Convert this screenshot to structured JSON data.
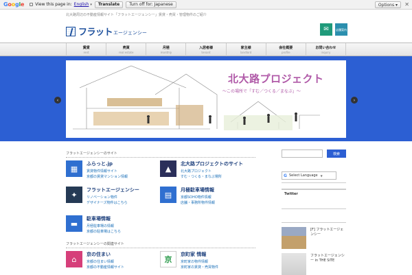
{
  "translate_bar": {
    "logo_letters": [
      "G",
      "o",
      "o",
      "g",
      "l",
      "e"
    ],
    "view_label": "View this page in:",
    "language": "English",
    "translate_label": "Translate",
    "turn_off_label": "Turn off for: Japanese",
    "options_label": "Options ▾",
    "close_label": "✕"
  },
  "header": {
    "tagline": "北大路周辺の不動産情報サイト「フラットエージェンシー」賃貸・売買・管理物件のご紹介",
    "logo_main": "フラット",
    "logo_sub": "エージェンシー",
    "mail_icon": "✉",
    "contact_label": "店舗案内"
  },
  "nav": [
    {
      "jp": "賃貸",
      "en": "rent"
    },
    {
      "jp": "売買",
      "en": "real estate"
    },
    {
      "jp": "月極",
      "en": "monthly"
    },
    {
      "jp": "入居者様",
      "en": "tenant"
    },
    {
      "jp": "家主様",
      "en": "landlord"
    },
    {
      "jp": "会社概要",
      "en": "profile"
    },
    {
      "jp": "お問い合わせ",
      "en": "inquiry"
    }
  ],
  "hero": {
    "title": "北大路プロジェクト",
    "subtitle": "～この場所で「すむ／つくる／まなぶ」～",
    "prev_label": "‹",
    "next_label": "›"
  },
  "sections": {
    "section1_title": "フラットエージェンシーのサイト",
    "section2_title": "フラットエージェンシーの関連サイト"
  },
  "cards": [
    {
      "title": "ふらっと.jp",
      "line1": "賃貸物件情報サイト",
      "line2": "京都の賃貸マンション情報"
    },
    {
      "title": "北大路プロジェクトのサイト",
      "line1": "北大路プロジェクト",
      "line2": "すむ・つくる・まなぶ場所"
    },
    {
      "title": "フラットエージェンシー",
      "line1": "リノベーション物件",
      "line2": "デザイナーズ物件はこちら"
    },
    {
      "title": "月極駐車場情報",
      "line1": "京都SOHO物件情報",
      "line2": "店舗・事務所物件情報"
    },
    {
      "title": "駐車場情報",
      "line1": "月極駐車場の情報",
      "line2": "京都の駐車場はこちら"
    },
    {
      "title": "京の住まい",
      "line1": "京都の住まい情報",
      "line2": "京都の不動産情報サイト"
    },
    {
      "title": "京町家 情報",
      "line1": "京町家の物件情報",
      "line2": "京町家の賃貸・売買物件"
    }
  ],
  "sidebar": {
    "search_placeholder": "",
    "search_button": "検索",
    "language_label": "Select Language",
    "g_mark": "G",
    "language_caret": "▼",
    "twitter_label": "Twitter",
    "news": [
      {
        "text": "[F] フラットエージェンシー"
      },
      {
        "text": "フラットエージェンシー in THE SITE"
      }
    ]
  },
  "colors": {
    "brand_blue": "#1c4f9c",
    "hero_blue": "#2c5fd3",
    "accent_purple": "#b05aa8",
    "icon_green": "#1f9a7a"
  }
}
